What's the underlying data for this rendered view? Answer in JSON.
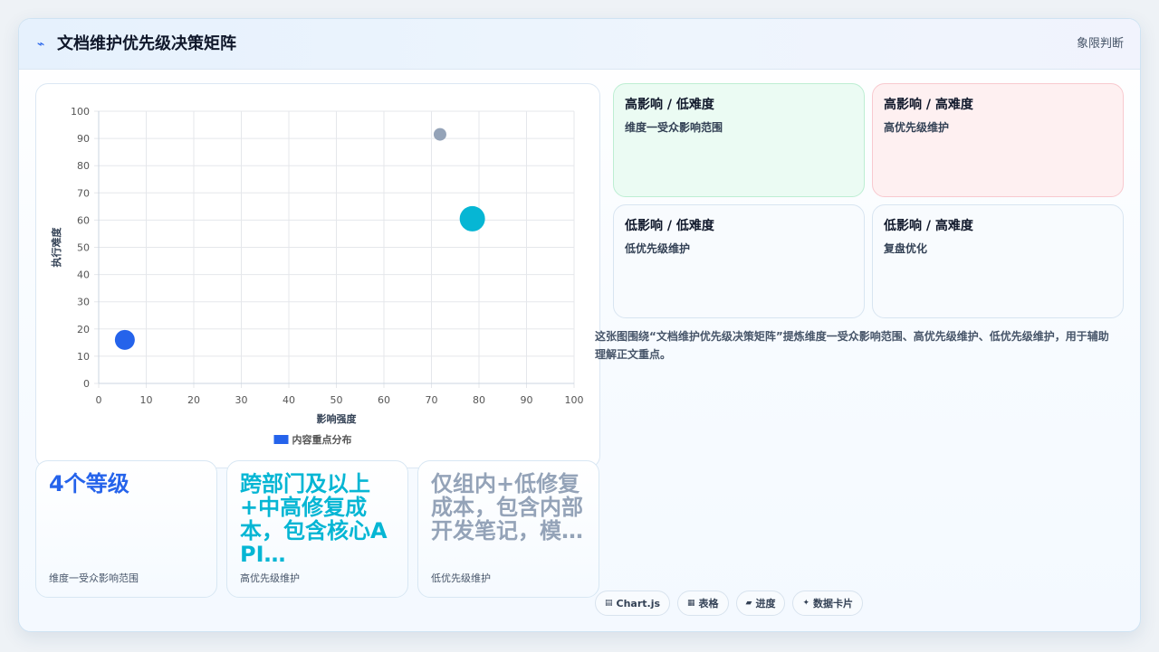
{
  "header": {
    "title": "文档维护优先级决策矩阵",
    "link": "象限判断",
    "icon": "lightning-icon"
  },
  "chart_data": {
    "type": "scatter",
    "title": "",
    "xlabel": "影响强度",
    "ylabel": "执行难度",
    "xlim": [
      0,
      100
    ],
    "ylim": [
      0,
      100
    ],
    "xticks": [
      0,
      10,
      20,
      30,
      40,
      50,
      60,
      70,
      80,
      90,
      100
    ],
    "yticks": [
      0,
      10,
      20,
      30,
      40,
      50,
      60,
      70,
      80,
      90,
      100
    ],
    "grid": true,
    "legend_position": "bottom",
    "series": [
      {
        "name": "内容重点分布",
        "legend_color": "#2563eb",
        "points": [
          {
            "x": 5.5,
            "y": 16,
            "size": 11,
            "color": "#2563eb"
          },
          {
            "x": 78.6,
            "y": 60.5,
            "size": 14,
            "color": "#06b6d4"
          },
          {
            "x": 71.8,
            "y": 91.5,
            "size": 7,
            "color": "#94a3b8"
          }
        ]
      }
    ]
  },
  "stats": [
    {
      "value": "4个等级",
      "label": "维度一受众影响范围",
      "color": "#2563eb"
    },
    {
      "value": "跨部门及以上+中高修复成本，包含核心API…",
      "label": "高优先级维护",
      "color": "#06b6d4"
    },
    {
      "value": "仅组内+低修复成本，包含内部开发笔记，模…",
      "label": "低优先级维护",
      "color": "#94a3b8"
    }
  ],
  "quadrants": [
    {
      "title": "高影响 / 低难度",
      "desc": "维度一受众影响范围",
      "bg": "#ebfbf3",
      "border": "#bdeed3"
    },
    {
      "title": "高影响 / 高难度",
      "desc": "高优先级维护",
      "bg": "#fef0f1",
      "border": "#f8c9cf"
    },
    {
      "title": "低影响 / 低难度",
      "desc": "低优先级维护",
      "bg": "#f8fbfe",
      "border": "#d8e5f1"
    },
    {
      "title": "低影响 / 高难度",
      "desc": "复盘优化",
      "bg": "#f8fbfe",
      "border": "#d8e5f1"
    }
  ],
  "description": "这张图围绕“文档维护优先级决策矩阵”提炼维度一受众影响范围、高优先级维护、低优先级维护，用于辅助理解正文重点。",
  "tags": [
    {
      "icon": "chart-icon",
      "glyph": "▤",
      "label": "Chart.js"
    },
    {
      "icon": "table-icon",
      "glyph": "▦",
      "label": "表格"
    },
    {
      "icon": "progress-icon",
      "glyph": "▰",
      "label": "进度"
    },
    {
      "icon": "sparkle-icon",
      "glyph": "✦",
      "label": "数据卡片"
    }
  ]
}
